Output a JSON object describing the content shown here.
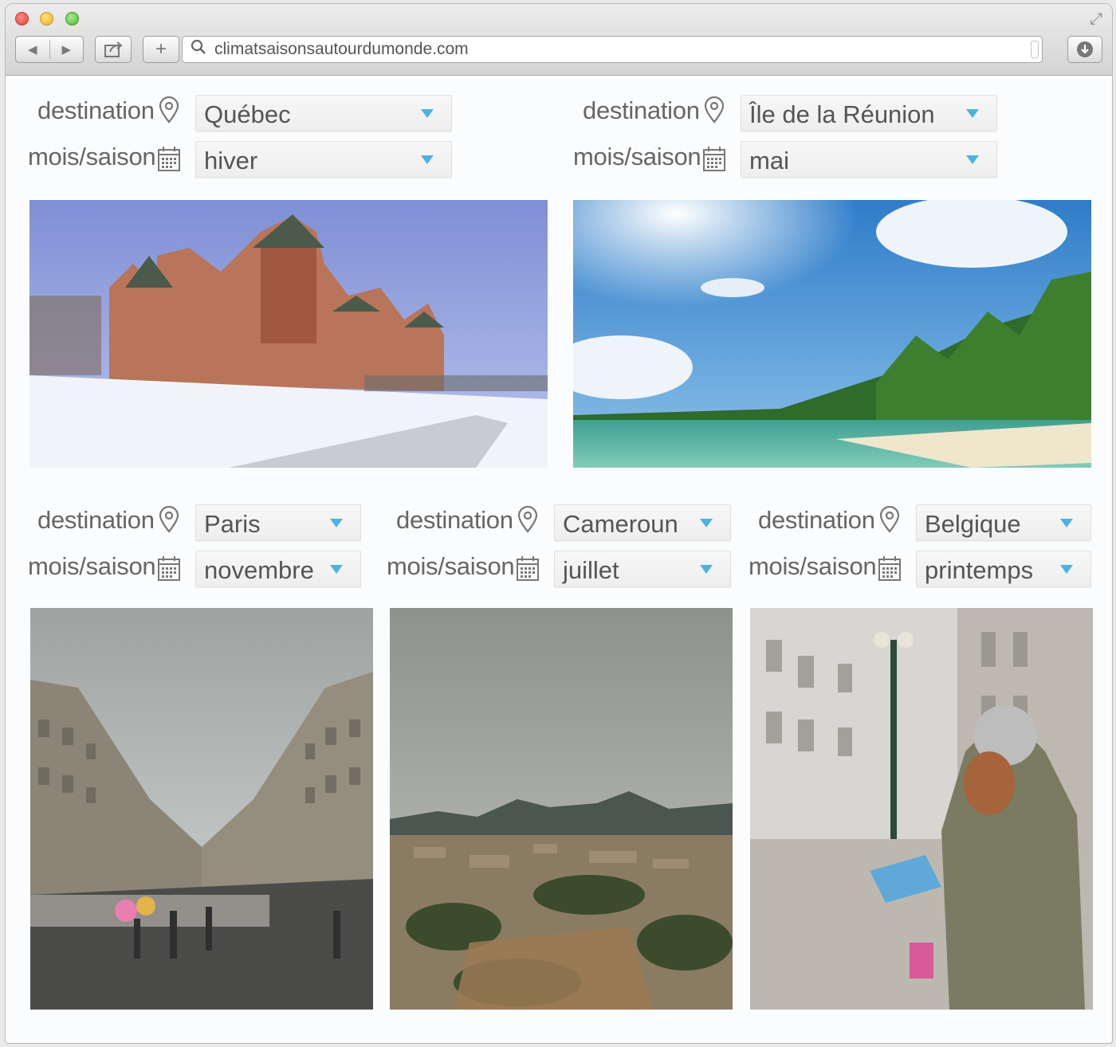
{
  "browser": {
    "url": "climatsaisonsautourdumonde.com",
    "icons": {
      "back": "back-arrow-icon",
      "forward": "forward-arrow-icon",
      "share": "share-icon",
      "new_tab": "plus-icon",
      "search": "search-icon",
      "download": "download-icon",
      "fullscreen": "fullscreen-icon"
    }
  },
  "labels": {
    "destination": "destination",
    "season": "mois/saison"
  },
  "cards": [
    {
      "destination": "Québec",
      "season": "hiver",
      "photo": "Château Frontenac in winter snow"
    },
    {
      "destination": "Île de la Réunion",
      "season": "mai",
      "photo": "Tropical beach with palm trees"
    },
    {
      "destination": "Paris",
      "season": "novembre",
      "photo": "Rainy Parisian avenue"
    },
    {
      "destination": "Cameroun",
      "season": "juillet",
      "photo": "City panorama with hills"
    },
    {
      "destination": "Belgique",
      "season": "printemps",
      "photo": "Tourist reading a map on a square"
    }
  ],
  "colors": {
    "caret": "#4bb3e0",
    "select_bg": "#f2f2f2",
    "label_text": "#666666"
  }
}
